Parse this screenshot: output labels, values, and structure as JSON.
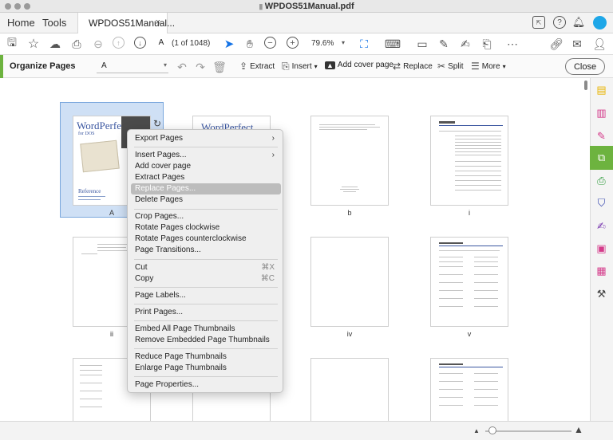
{
  "window": {
    "title": "WPDOS51Manual.pdf"
  },
  "tabs": {
    "home": "Home",
    "tools": "Tools",
    "document": "WPDOS51Manual...",
    "close_glyph": "×"
  },
  "toolbar": {
    "page_value": "A",
    "page_count": "(1 of 1048)",
    "zoom": "79.6%"
  },
  "organize": {
    "title": "Organize Pages",
    "range_value": "A",
    "extract": "Extract",
    "insert": "Insert",
    "add_cover": "Add cover page",
    "replace": "Replace",
    "split": "Split",
    "more": "More",
    "close": "Close"
  },
  "thumbnails": [
    {
      "label": "A"
    },
    {
      "label": "b"
    },
    {
      "label": "i"
    },
    {
      "label": "ii"
    },
    {
      "label": "iv"
    },
    {
      "label": "v"
    }
  ],
  "cover": {
    "brand": "WordPerfect",
    "sub": "for DOS",
    "ref": "Reference",
    "brand2": "WordPerfect"
  },
  "context_menu": {
    "items": [
      {
        "label": "Export Pages",
        "submenu": true
      },
      {
        "label": "Insert Pages...",
        "submenu": true
      },
      {
        "label": "Add cover page"
      },
      {
        "label": "Extract Pages"
      },
      {
        "label": "Replace Pages...",
        "highlighted": true
      },
      {
        "label": "Delete Pages"
      },
      {
        "label": "Crop Pages..."
      },
      {
        "label": "Rotate Pages clockwise"
      },
      {
        "label": "Rotate Pages counterclockwise"
      },
      {
        "label": "Page Transitions..."
      },
      {
        "label": "Cut",
        "shortcut": "⌘X"
      },
      {
        "label": "Copy",
        "shortcut": "⌘C"
      },
      {
        "label": "Page Labels..."
      },
      {
        "label": "Print Pages..."
      },
      {
        "label": "Embed All Page Thumbnails"
      },
      {
        "label": "Remove Embedded Page Thumbnails"
      },
      {
        "label": "Reduce Page Thumbnails"
      },
      {
        "label": "Enlarge Page Thumbnails"
      },
      {
        "label": "Page Properties..."
      }
    ]
  },
  "icons": {
    "save": "save-icon",
    "star": "star-icon",
    "upload": "cloud-upload-icon",
    "print": "print-icon",
    "zoom_out_search": "search-minus-icon",
    "prev": "arrow-up-icon",
    "next": "arrow-down-icon",
    "select": "cursor-icon",
    "hand": "hand-icon",
    "zoom_out": "minus-icon",
    "zoom_in": "plus-icon"
  },
  "colors": {
    "accent": "#6db33f",
    "selection": "#cfe0f5",
    "cursor": "#1473e6"
  }
}
